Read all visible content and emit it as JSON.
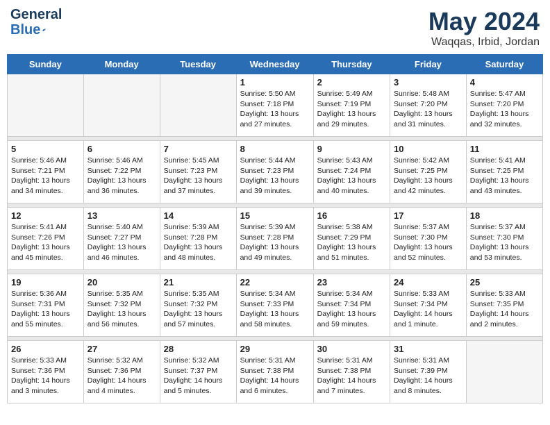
{
  "header": {
    "logo_text_general": "General",
    "logo_text_blue": "Blue",
    "month": "May 2024",
    "location": "Waqqas, Irbid, Jordan"
  },
  "days_of_week": [
    "Sunday",
    "Monday",
    "Tuesday",
    "Wednesday",
    "Thursday",
    "Friday",
    "Saturday"
  ],
  "weeks": [
    [
      {
        "day": "",
        "info": ""
      },
      {
        "day": "",
        "info": ""
      },
      {
        "day": "",
        "info": ""
      },
      {
        "day": "1",
        "info": "Sunrise: 5:50 AM\nSunset: 7:18 PM\nDaylight: 13 hours\nand 27 minutes."
      },
      {
        "day": "2",
        "info": "Sunrise: 5:49 AM\nSunset: 7:19 PM\nDaylight: 13 hours\nand 29 minutes."
      },
      {
        "day": "3",
        "info": "Sunrise: 5:48 AM\nSunset: 7:20 PM\nDaylight: 13 hours\nand 31 minutes."
      },
      {
        "day": "4",
        "info": "Sunrise: 5:47 AM\nSunset: 7:20 PM\nDaylight: 13 hours\nand 32 minutes."
      }
    ],
    [
      {
        "day": "5",
        "info": "Sunrise: 5:46 AM\nSunset: 7:21 PM\nDaylight: 13 hours\nand 34 minutes."
      },
      {
        "day": "6",
        "info": "Sunrise: 5:46 AM\nSunset: 7:22 PM\nDaylight: 13 hours\nand 36 minutes."
      },
      {
        "day": "7",
        "info": "Sunrise: 5:45 AM\nSunset: 7:23 PM\nDaylight: 13 hours\nand 37 minutes."
      },
      {
        "day": "8",
        "info": "Sunrise: 5:44 AM\nSunset: 7:23 PM\nDaylight: 13 hours\nand 39 minutes."
      },
      {
        "day": "9",
        "info": "Sunrise: 5:43 AM\nSunset: 7:24 PM\nDaylight: 13 hours\nand 40 minutes."
      },
      {
        "day": "10",
        "info": "Sunrise: 5:42 AM\nSunset: 7:25 PM\nDaylight: 13 hours\nand 42 minutes."
      },
      {
        "day": "11",
        "info": "Sunrise: 5:41 AM\nSunset: 7:25 PM\nDaylight: 13 hours\nand 43 minutes."
      }
    ],
    [
      {
        "day": "12",
        "info": "Sunrise: 5:41 AM\nSunset: 7:26 PM\nDaylight: 13 hours\nand 45 minutes."
      },
      {
        "day": "13",
        "info": "Sunrise: 5:40 AM\nSunset: 7:27 PM\nDaylight: 13 hours\nand 46 minutes."
      },
      {
        "day": "14",
        "info": "Sunrise: 5:39 AM\nSunset: 7:28 PM\nDaylight: 13 hours\nand 48 minutes."
      },
      {
        "day": "15",
        "info": "Sunrise: 5:39 AM\nSunset: 7:28 PM\nDaylight: 13 hours\nand 49 minutes."
      },
      {
        "day": "16",
        "info": "Sunrise: 5:38 AM\nSunset: 7:29 PM\nDaylight: 13 hours\nand 51 minutes."
      },
      {
        "day": "17",
        "info": "Sunrise: 5:37 AM\nSunset: 7:30 PM\nDaylight: 13 hours\nand 52 minutes."
      },
      {
        "day": "18",
        "info": "Sunrise: 5:37 AM\nSunset: 7:30 PM\nDaylight: 13 hours\nand 53 minutes."
      }
    ],
    [
      {
        "day": "19",
        "info": "Sunrise: 5:36 AM\nSunset: 7:31 PM\nDaylight: 13 hours\nand 55 minutes."
      },
      {
        "day": "20",
        "info": "Sunrise: 5:35 AM\nSunset: 7:32 PM\nDaylight: 13 hours\nand 56 minutes."
      },
      {
        "day": "21",
        "info": "Sunrise: 5:35 AM\nSunset: 7:32 PM\nDaylight: 13 hours\nand 57 minutes."
      },
      {
        "day": "22",
        "info": "Sunrise: 5:34 AM\nSunset: 7:33 PM\nDaylight: 13 hours\nand 58 minutes."
      },
      {
        "day": "23",
        "info": "Sunrise: 5:34 AM\nSunset: 7:34 PM\nDaylight: 13 hours\nand 59 minutes."
      },
      {
        "day": "24",
        "info": "Sunrise: 5:33 AM\nSunset: 7:34 PM\nDaylight: 14 hours\nand 1 minute."
      },
      {
        "day": "25",
        "info": "Sunrise: 5:33 AM\nSunset: 7:35 PM\nDaylight: 14 hours\nand 2 minutes."
      }
    ],
    [
      {
        "day": "26",
        "info": "Sunrise: 5:33 AM\nSunset: 7:36 PM\nDaylight: 14 hours\nand 3 minutes."
      },
      {
        "day": "27",
        "info": "Sunrise: 5:32 AM\nSunset: 7:36 PM\nDaylight: 14 hours\nand 4 minutes."
      },
      {
        "day": "28",
        "info": "Sunrise: 5:32 AM\nSunset: 7:37 PM\nDaylight: 14 hours\nand 5 minutes."
      },
      {
        "day": "29",
        "info": "Sunrise: 5:31 AM\nSunset: 7:38 PM\nDaylight: 14 hours\nand 6 minutes."
      },
      {
        "day": "30",
        "info": "Sunrise: 5:31 AM\nSunset: 7:38 PM\nDaylight: 14 hours\nand 7 minutes."
      },
      {
        "day": "31",
        "info": "Sunrise: 5:31 AM\nSunset: 7:39 PM\nDaylight: 14 hours\nand 8 minutes."
      },
      {
        "day": "",
        "info": ""
      }
    ]
  ]
}
